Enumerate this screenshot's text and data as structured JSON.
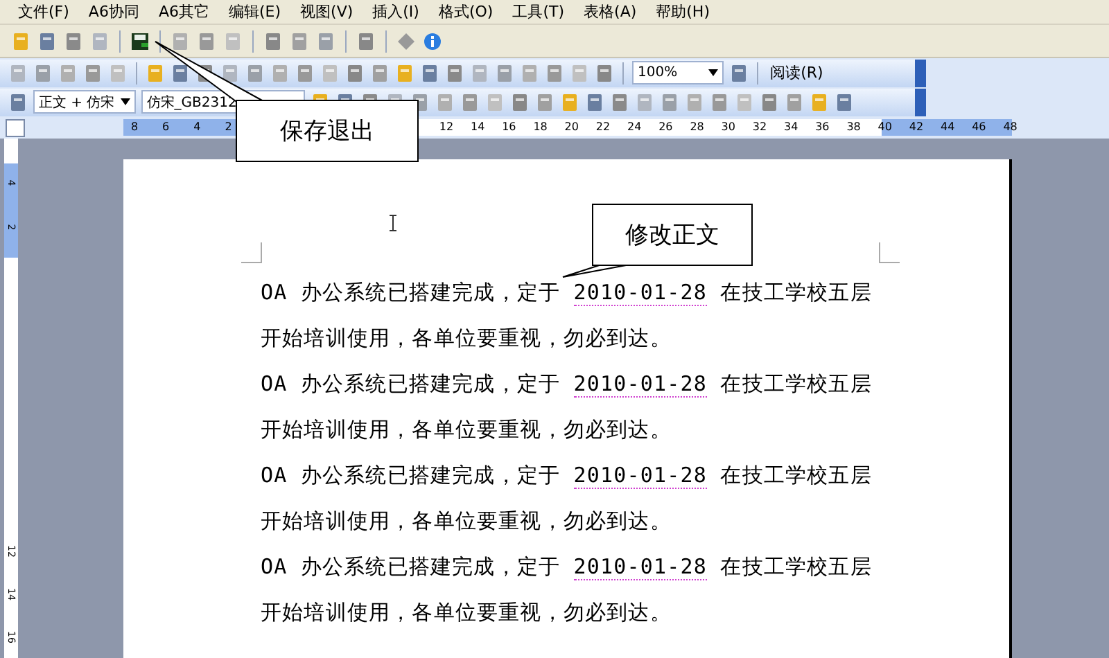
{
  "menu": [
    "文件(F)",
    "A6协同",
    "A6其它",
    "编辑(E)",
    "视图(V)",
    "插入(I)",
    "格式(O)",
    "工具(T)",
    "表格(A)",
    "帮助(H)"
  ],
  "toolbar": {
    "zoom": "100%",
    "read_button": "阅读(R)",
    "style": "正文 + 仿宋",
    "font": "仿宋_GB2312"
  },
  "ruler": {
    "left_labels": [
      "8",
      "6",
      "4",
      "2"
    ],
    "right_labels": [
      "12",
      "14",
      "16",
      "18",
      "20",
      "22",
      "24",
      "26",
      "28",
      "30",
      "32",
      "34",
      "36",
      "38",
      "40",
      "42",
      "44",
      "46",
      "48"
    ],
    "vertical_labels": [
      "4",
      "2",
      "12",
      "14",
      "16"
    ]
  },
  "document": {
    "lines": [
      {
        "kind": "dated",
        "before": "OA 办公系统已搭建完成，定于 ",
        "date": "2010-01-28",
        "after": " 在技工学校五层"
      },
      {
        "kind": "plain",
        "text": "开始培训使用，各单位要重视，勿必到达。"
      },
      {
        "kind": "dated",
        "before": "OA 办公系统已搭建完成，定于 ",
        "date": "2010-01-28",
        "after": " 在技工学校五层"
      },
      {
        "kind": "plain",
        "text": "开始培训使用，各单位要重视，勿必到达。"
      },
      {
        "kind": "dated",
        "before": "OA 办公系统已搭建完成，定于 ",
        "date": "2010-01-28",
        "after": " 在技工学校五层"
      },
      {
        "kind": "plain",
        "text": "开始培训使用，各单位要重视，勿必到达。"
      },
      {
        "kind": "dated",
        "before": "OA 办公系统已搭建完成，定于 ",
        "date": "2010-01-28",
        "after": " 在技工学校五层"
      },
      {
        "kind": "plain",
        "text": "开始培训使用，各单位要重视，勿必到达。"
      }
    ]
  },
  "callouts": [
    {
      "text": "保存退出"
    },
    {
      "text": "修改正文"
    }
  ]
}
